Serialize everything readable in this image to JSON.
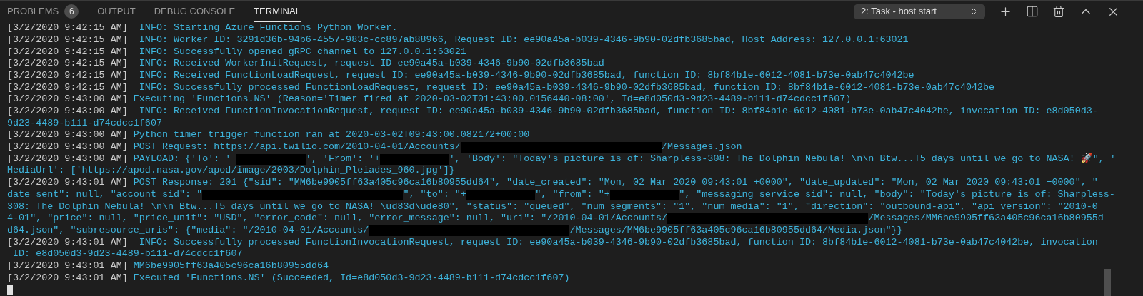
{
  "tabs": [
    {
      "label": "PROBLEMS",
      "badge": "6",
      "selected": false
    },
    {
      "label": "OUTPUT",
      "selected": false
    },
    {
      "label": "DEBUG CONSOLE",
      "selected": false
    },
    {
      "label": "TERMINAL",
      "selected": true
    }
  ],
  "terminal_select": {
    "value": "2: Task - host start"
  },
  "lines": [
    {
      "time": "[3/2/2020 9:42:15 AM]",
      "segments": [
        {
          "kind": "text",
          "text": "  INFO: Starting Azure Functions Python Worker."
        }
      ]
    },
    {
      "time": "[3/2/2020 9:42:15 AM]",
      "segments": [
        {
          "kind": "text",
          "text": "  INFO: Worker ID: 3291d36b-94b6-4557-983c-cc897ab88966, Request ID: ee90a45a-b039-4346-9b90-02dfb3685bad, Host Address: 127.0.0.1:63021"
        }
      ]
    },
    {
      "time": "[3/2/2020 9:42:15 AM]",
      "segments": [
        {
          "kind": "text",
          "text": "  INFO: Successfully opened gRPC channel to 127.0.0.1:63021"
        }
      ]
    },
    {
      "time": "[3/2/2020 9:42:15 AM]",
      "segments": [
        {
          "kind": "text",
          "text": "  INFO: Received WorkerInitRequest, request ID ee90a45a-b039-4346-9b90-02dfb3685bad"
        }
      ]
    },
    {
      "time": "[3/2/2020 9:42:15 AM]",
      "segments": [
        {
          "kind": "text",
          "text": "  INFO: Received FunctionLoadRequest, request ID: ee90a45a-b039-4346-9b90-02dfb3685bad, function ID: 8bf84b1e-6012-4081-b73e-0ab47c4042be"
        }
      ]
    },
    {
      "time": "[3/2/2020 9:42:15 AM]",
      "segments": [
        {
          "kind": "text",
          "text": "  INFO: Successfully processed FunctionLoadRequest, request ID: ee90a45a-b039-4346-9b90-02dfb3685bad, function ID: 8bf84b1e-6012-4081-b73e-0ab47c4042be"
        }
      ]
    },
    {
      "time": "[3/2/2020 9:43:00 AM]",
      "segments": [
        {
          "kind": "text",
          "text": " Executing 'Functions.NS' (Reason='Timer fired at 2020-03-02T01:43:00.0156440-08:00', Id=e8d050d3-9d23-4489-b111-d74cdcc1f607)"
        }
      ]
    },
    {
      "time": "[3/2/2020 9:43:00 AM]",
      "segments": [
        {
          "kind": "text",
          "text": "  INFO: Received FunctionInvocationRequest, request ID: ee90a45a-b039-4346-9b90-02dfb3685bad, function ID: 8bf84b1e-6012-4081-b73e-0ab47c4042be, invocation ID: e8d050d3-"
        }
      ]
    },
    {
      "segments": [
        {
          "kind": "text",
          "text": "9d23-4489-b111-d74cdcc1f607"
        }
      ]
    },
    {
      "time": "[3/2/2020 9:43:00 AM]",
      "segments": [
        {
          "kind": "text",
          "text": " Python timer trigger function ran at 2020-03-02T09:43:00.082172+00:00"
        }
      ]
    },
    {
      "time": "[3/2/2020 9:43:00 AM]",
      "segments": [
        {
          "kind": "text",
          "text": " POST Request: https://api.twilio.com/2010-04-01/Accounts/"
        },
        {
          "kind": "redacted_sid"
        },
        {
          "kind": "text",
          "text": "/Messages.json"
        }
      ]
    },
    {
      "time": "[3/2/2020 9:43:00 AM]",
      "segments": [
        {
          "kind": "text",
          "text": " PAYLOAD: {'To': '+"
        },
        {
          "kind": "redacted_phone"
        },
        {
          "kind": "text",
          "text": "', 'From': '+"
        },
        {
          "kind": "redacted_phone"
        },
        {
          "kind": "text",
          "text": "', 'Body': \"Today's picture is of: Sharpless-308: The Dolphin Nebula! \\n\\n Btw...T5 days until we go to NASA! 🚀\", '"
        }
      ]
    },
    {
      "segments": [
        {
          "kind": "text",
          "text": "MediaUrl': ['https://apod.nasa.gov/apod/image/2003/Dolphin_Pleiades_960.jpg']}"
        }
      ]
    },
    {
      "time": "[3/2/2020 9:43:01 AM]",
      "segments": [
        {
          "kind": "text",
          "text": " POST Response: 201 {\"sid\": \"MM6be9905ff63a405c96ca16b80955dd64\", \"date_created\": \"Mon, 02 Mar 2020 09:43:01 +0000\", \"date_updated\": \"Mon, 02 Mar 2020 09:43:01 +0000\", \""
        }
      ]
    },
    {
      "segments": [
        {
          "kind": "text",
          "text": "date_sent\": null, \"account_sid\": \""
        },
        {
          "kind": "redacted_sid"
        },
        {
          "kind": "text",
          "text": "\", \"to\": \"+"
        },
        {
          "kind": "redacted_phone"
        },
        {
          "kind": "text",
          "text": "\", \"from\": \"+"
        },
        {
          "kind": "redacted_phone"
        },
        {
          "kind": "text",
          "text": "\", \"messaging_service_sid\": null, \"body\": \"Today's picture is of: Sharpless-"
        }
      ]
    },
    {
      "segments": [
        {
          "kind": "text",
          "text": "308: The Dolphin Nebula! \\n\\n Btw...T5 days until we go to NASA! \\ud83d\\ude80\", \"status\": \"queued\", \"num_segments\": \"1\", \"num_media\": \"1\", \"direction\": \"outbound-api\", \"api_version\": \"2010-0"
        }
      ]
    },
    {
      "segments": [
        {
          "kind": "text",
          "text": "4-01\", \"price\": null, \"price_unit\": \"USD\", \"error_code\": null, \"error_message\": null, \"uri\": \"/2010-04-01/Accounts/"
        },
        {
          "kind": "redacted_sid"
        },
        {
          "kind": "text",
          "text": "/Messages/MM6be9905ff63a405c96ca16b80955d"
        }
      ]
    },
    {
      "segments": [
        {
          "kind": "text",
          "text": "d64.json\", \"subresource_uris\": {\"media\": \"/2010-04-01/Accounts/"
        },
        {
          "kind": "redacted_sid"
        },
        {
          "kind": "text",
          "text": "/Messages/MM6be9905ff63a405c96ca16b80955dd64/Media.json\"}}"
        }
      ]
    },
    {
      "time": "[3/2/2020 9:43:01 AM]",
      "segments": [
        {
          "kind": "text",
          "text": "  INFO: Successfully processed FunctionInvocationRequest, request ID: ee90a45a-b039-4346-9b90-02dfb3685bad, function ID: 8bf84b1e-6012-4081-b73e-0ab47c4042be, invocation"
        }
      ]
    },
    {
      "segments": [
        {
          "kind": "text",
          "text": " ID: e8d050d3-9d23-4489-b111-d74cdcc1f607"
        }
      ]
    },
    {
      "time": "[3/2/2020 9:43:01 AM]",
      "segments": [
        {
          "kind": "text",
          "text": " MM6be9905ff63a405c96ca16b80955dd64"
        }
      ]
    },
    {
      "time": "[3/2/2020 9:43:01 AM]",
      "segments": [
        {
          "kind": "text",
          "text": " Executed 'Functions.NS' (Succeeded, Id=e8d050d3-9d23-4489-b111-d74cdcc1f607)"
        }
      ]
    }
  ]
}
